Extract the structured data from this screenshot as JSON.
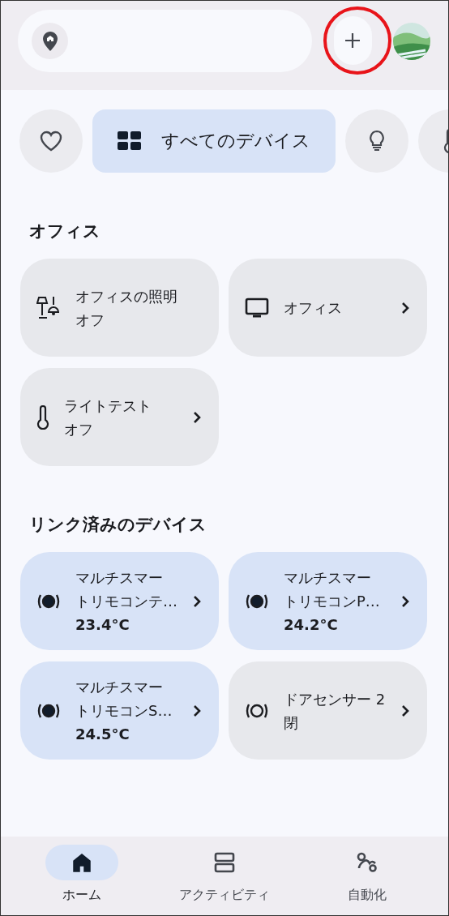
{
  "top_bar": {
    "add_button": {
      "highlighted": true
    }
  },
  "filters": [
    {
      "kind": "favorites",
      "selected": false
    },
    {
      "kind": "all",
      "label": "すべてのデバイス",
      "selected": true
    },
    {
      "kind": "lights",
      "selected": false
    },
    {
      "kind": "climate",
      "selected": false
    }
  ],
  "sections": [
    {
      "title": "オフィス",
      "cards": [
        {
          "kind": "lamp",
          "name_lines": [
            "オフィスの照明"
          ],
          "status": "オフ",
          "active": false,
          "chevron": false
        },
        {
          "kind": "tv",
          "name_lines": [
            "オフィス"
          ],
          "active": false,
          "chevron": true
        },
        {
          "kind": "thermometer",
          "name_lines": [
            "ライトテスト"
          ],
          "status": "オフ",
          "active": false,
          "chevron": true
        }
      ]
    },
    {
      "title": "リンク済みのデバイス",
      "cards": [
        {
          "kind": "sensor",
          "name_lines": [
            "マルチスマー",
            "トリモコンテ…"
          ],
          "status": "23.4°C",
          "active": true,
          "chevron": true
        },
        {
          "kind": "sensor",
          "name_lines": [
            "マルチスマー",
            "トリモコンP…"
          ],
          "status": "24.2°C",
          "active": true,
          "chevron": true
        },
        {
          "kind": "sensor",
          "name_lines": [
            "マルチスマー",
            "トリモコンS…"
          ],
          "status": "24.5°C",
          "active": true,
          "chevron": true
        },
        {
          "kind": "sensor",
          "name_lines": [
            "ドアセンサー 2"
          ],
          "status": "閉",
          "active": false,
          "chevron": true
        }
      ]
    }
  ],
  "nav": [
    {
      "kind": "home",
      "label": "ホーム",
      "selected": true
    },
    {
      "kind": "activity",
      "label": "アクティビティ",
      "selected": false
    },
    {
      "kind": "automation",
      "label": "自動化",
      "selected": false
    }
  ]
}
